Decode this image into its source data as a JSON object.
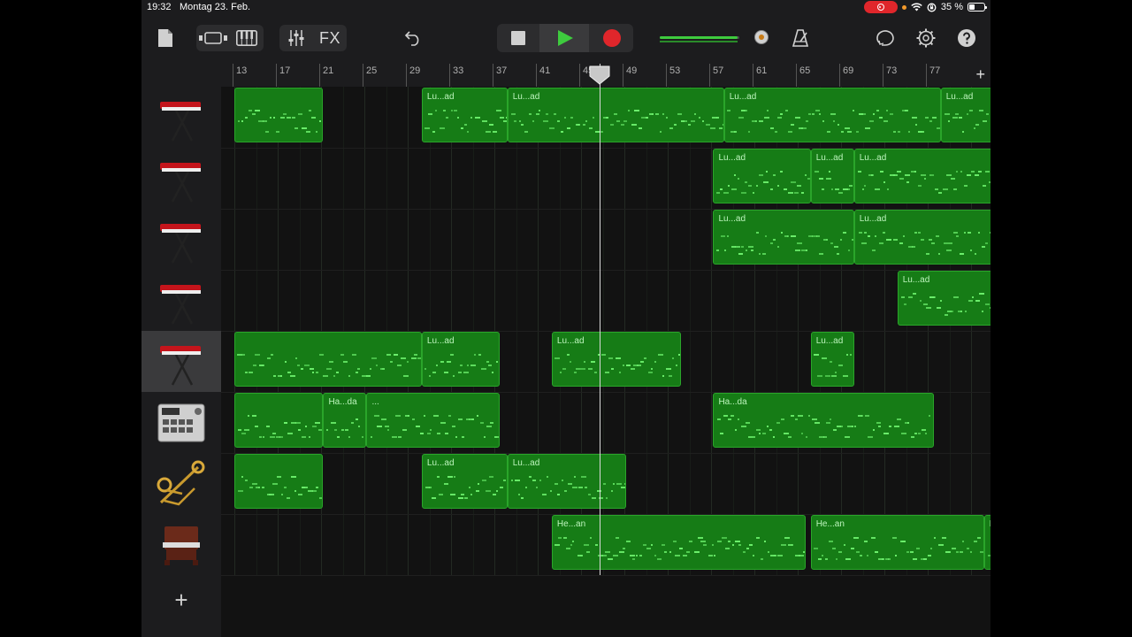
{
  "status_bar": {
    "time": "19:32",
    "date": "Montag 23. Feb.",
    "battery_percent": "35 %"
  },
  "toolbar": {
    "fx_label": "FX",
    "master_volume": 0.98
  },
  "ruler": {
    "bars": [
      "13",
      "17",
      "21",
      "25",
      "29",
      "33",
      "37",
      "41",
      "45",
      "49",
      "53",
      "57",
      "61",
      "65",
      "69",
      "73",
      "77"
    ]
  },
  "tracks": [
    {
      "instrument": "keyboard-icon",
      "selected": false
    },
    {
      "instrument": "keyboard-icon",
      "selected": false
    },
    {
      "instrument": "keyboard-icon",
      "selected": false
    },
    {
      "instrument": "keyboard-icon",
      "selected": false
    },
    {
      "instrument": "keyboard-icon",
      "selected": true
    },
    {
      "instrument": "drum-machine-icon",
      "selected": false
    },
    {
      "instrument": "brass-icon",
      "selected": false
    },
    {
      "instrument": "organ-icon",
      "selected": false
    }
  ],
  "regions": [
    {
      "track": 0,
      "start": 13,
      "end": 21.2,
      "label": ""
    },
    {
      "track": 0,
      "start": 30.3,
      "end": 38.2,
      "label": "Lu...ad"
    },
    {
      "track": 0,
      "start": 38.2,
      "end": 58.2,
      "label": "Lu...ad"
    },
    {
      "track": 0,
      "start": 58.2,
      "end": 78.2,
      "label": "Lu...ad"
    },
    {
      "track": 0,
      "start": 78.2,
      "end": 84,
      "label": "Lu...ad"
    },
    {
      "track": 1,
      "start": 57.2,
      "end": 66.2,
      "label": "Lu...ad"
    },
    {
      "track": 1,
      "start": 66.2,
      "end": 70.2,
      "label": "Lu...ad"
    },
    {
      "track": 1,
      "start": 70.2,
      "end": 84,
      "label": "Lu...ad"
    },
    {
      "track": 2,
      "start": 57.2,
      "end": 70.2,
      "label": "Lu...ad"
    },
    {
      "track": 2,
      "start": 70.2,
      "end": 84,
      "label": "Lu...ad"
    },
    {
      "track": 3,
      "start": 74.2,
      "end": 84,
      "label": "Lu...ad"
    },
    {
      "track": 4,
      "start": 13,
      "end": 30.3,
      "label": ""
    },
    {
      "track": 4,
      "start": 30.3,
      "end": 37.5,
      "label": "Lu...ad"
    },
    {
      "track": 4,
      "start": 42.3,
      "end": 54.2,
      "label": "Lu...ad"
    },
    {
      "track": 4,
      "start": 66.2,
      "end": 70.2,
      "label": "Lu...ad"
    },
    {
      "track": 5,
      "start": 13,
      "end": 21.2,
      "label": ""
    },
    {
      "track": 5,
      "start": 21.2,
      "end": 25.2,
      "label": "Ha...da"
    },
    {
      "track": 5,
      "start": 25.2,
      "end": 37.5,
      "label": "..."
    },
    {
      "track": 5,
      "start": 57.2,
      "end": 77.6,
      "label": "Ha...da"
    },
    {
      "track": 6,
      "start": 13,
      "end": 21.2,
      "label": ""
    },
    {
      "track": 6,
      "start": 30.3,
      "end": 38.2,
      "label": "Lu...ad"
    },
    {
      "track": 6,
      "start": 38.2,
      "end": 49.2,
      "label": "Lu...ad"
    },
    {
      "track": 7,
      "start": 42.3,
      "end": 65.7,
      "label": "He...an"
    },
    {
      "track": 7,
      "start": 66.2,
      "end": 82.2,
      "label": "He...an"
    },
    {
      "track": 7,
      "start": 82.2,
      "end": 84,
      "label": "He..."
    }
  ],
  "playhead_bar": 46.7,
  "colors": {
    "region_fill": "#167c16",
    "region_border": "#2aa52a",
    "note": "#6cf06c",
    "record": "#e0262b",
    "play": "#3ecb3e"
  }
}
